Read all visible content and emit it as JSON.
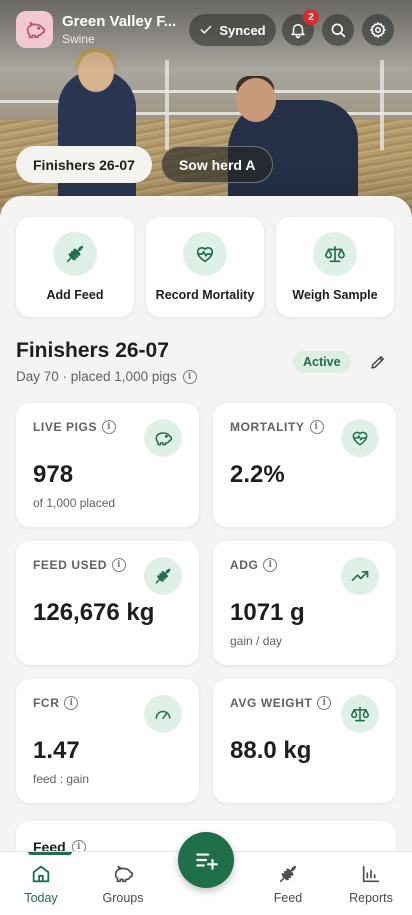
{
  "header": {
    "farm_name": "Green Valley F...",
    "farm_type": "Swine",
    "sync_status": "Synced",
    "notification_count": "2"
  },
  "group_chips": [
    {
      "label": "Finishers 26-07",
      "active": true
    },
    {
      "label": "Sow herd A",
      "active": false
    }
  ],
  "quick_actions": [
    {
      "label": "Add Feed",
      "icon": "wheat-icon"
    },
    {
      "label": "Record Mortality",
      "icon": "heart-pulse-icon"
    },
    {
      "label": "Weigh Sample",
      "icon": "scale-icon"
    }
  ],
  "group": {
    "title": "Finishers 26-07",
    "subtitle": "Day 70 · placed 1,000 pigs",
    "status": "Active"
  },
  "metrics": [
    {
      "label": "LIVE PIGS",
      "value": "978",
      "sub": "of 1,000 placed",
      "icon": "pig-icon"
    },
    {
      "label": "MORTALITY",
      "value": "2.2%",
      "sub": "",
      "icon": "heart-pulse-icon"
    },
    {
      "label": "FEED USED",
      "value": "126,676 kg",
      "sub": "",
      "icon": "wheat-icon"
    },
    {
      "label": "ADG",
      "value": "1071 g",
      "sub": "gain / day",
      "icon": "trend-up-icon"
    },
    {
      "label": "FCR",
      "value": "1.47",
      "sub": "feed : gain",
      "icon": "gauge-icon"
    },
    {
      "label": "AVG WEIGHT",
      "value": "88.0 kg",
      "sub": "",
      "icon": "scale-icon"
    }
  ],
  "feed_section": {
    "label": "Feed"
  },
  "bottom_nav": [
    {
      "label": "Today",
      "icon": "home-icon",
      "active": true
    },
    {
      "label": "Groups",
      "icon": "pig-icon",
      "active": false
    },
    {
      "label": "Feed",
      "icon": "wheat-icon",
      "active": false
    },
    {
      "label": "Reports",
      "icon": "bar-chart-icon",
      "active": false
    }
  ],
  "colors": {
    "accent": "#1e6f4a",
    "accent_soft": "#dff1e6",
    "badge": "#d92d2d"
  }
}
